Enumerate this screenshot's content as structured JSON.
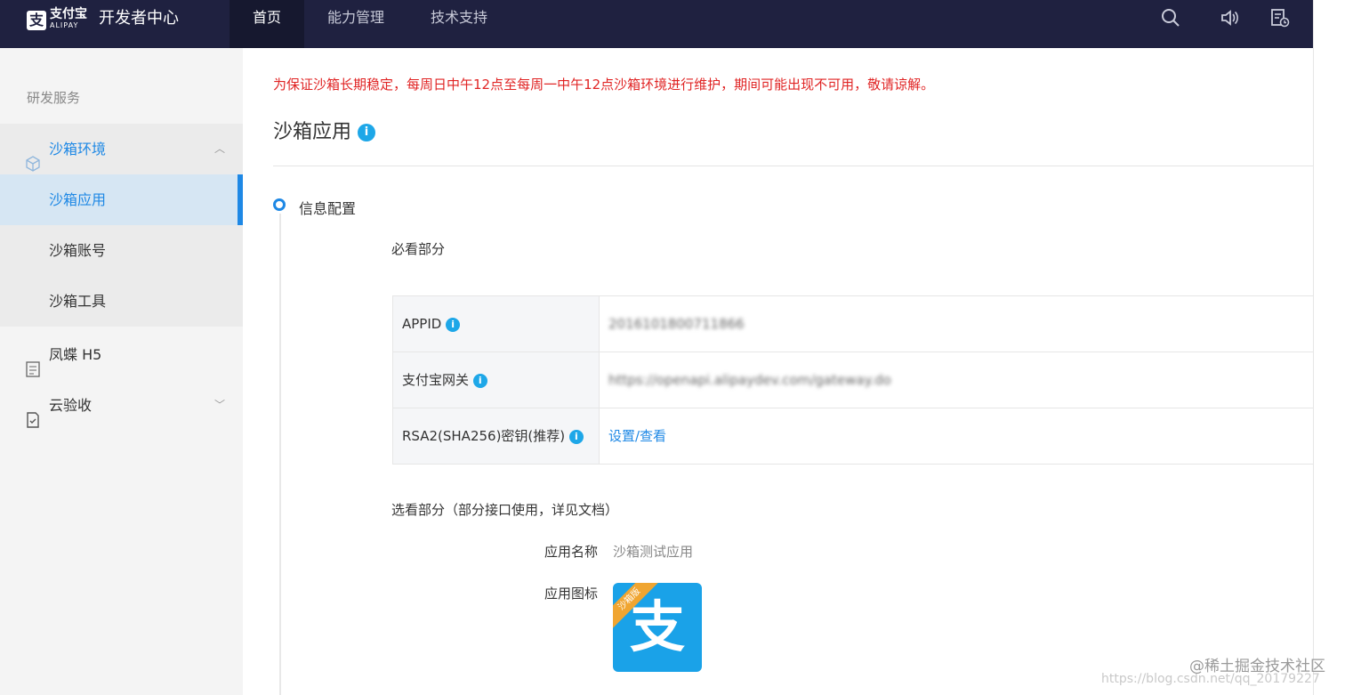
{
  "header": {
    "logo_cn": "支付宝",
    "logo_en": "ALIPAY",
    "site_title": "开发者中心",
    "nav": [
      "首页",
      "能力管理",
      "技术支持"
    ],
    "icons": [
      "search-icon",
      "speaker-icon",
      "notice-icon"
    ]
  },
  "sidebar": {
    "group_title": "研发服务",
    "items": [
      {
        "label": "沙箱环境",
        "icon": "box-icon",
        "expanded": true
      },
      {
        "label": "沙箱应用",
        "selected": true
      },
      {
        "label": "沙箱账号"
      },
      {
        "label": "沙箱工具"
      },
      {
        "label": "凤蝶 H5",
        "icon": "page-icon"
      },
      {
        "label": "云验收",
        "icon": "doc-check-icon",
        "expanded": false
      }
    ]
  },
  "main": {
    "notice": "为保证沙箱长期稳定，每周日中午12点至每周一中午12点沙箱环境进行维护，期间可能出现不可用，敬请谅解。",
    "title": "沙箱应用",
    "step_label": "信息配置",
    "required_section": "必看部分",
    "table": [
      {
        "key": "APPID",
        "value": "2016101800711866",
        "has_info": true,
        "blurred": true
      },
      {
        "key": "支付宝网关",
        "value": "https://openapi.alipaydev.com/gateway.do",
        "has_info": true,
        "blurred": true
      },
      {
        "key": "RSA2(SHA256)密钥(推荐)",
        "value": "设置/查看",
        "has_info": true,
        "link": true
      }
    ],
    "optional_section": "选看部分（部分接口使用，详见文档）",
    "app_name_label": "应用名称",
    "app_name_value": "沙箱测试应用",
    "app_icon_label": "应用图标",
    "app_icon_ribbon": "沙箱版",
    "app_icon_glyph": "支"
  },
  "watermark": "@稀土掘金技术社区",
  "watermark_url": "https://blog.csdn.net/qq_20179227",
  "colors": {
    "topbar": "#1f2140",
    "accent": "#1e88e5",
    "notice": "#e02424",
    "info": "#1ea7e8"
  }
}
